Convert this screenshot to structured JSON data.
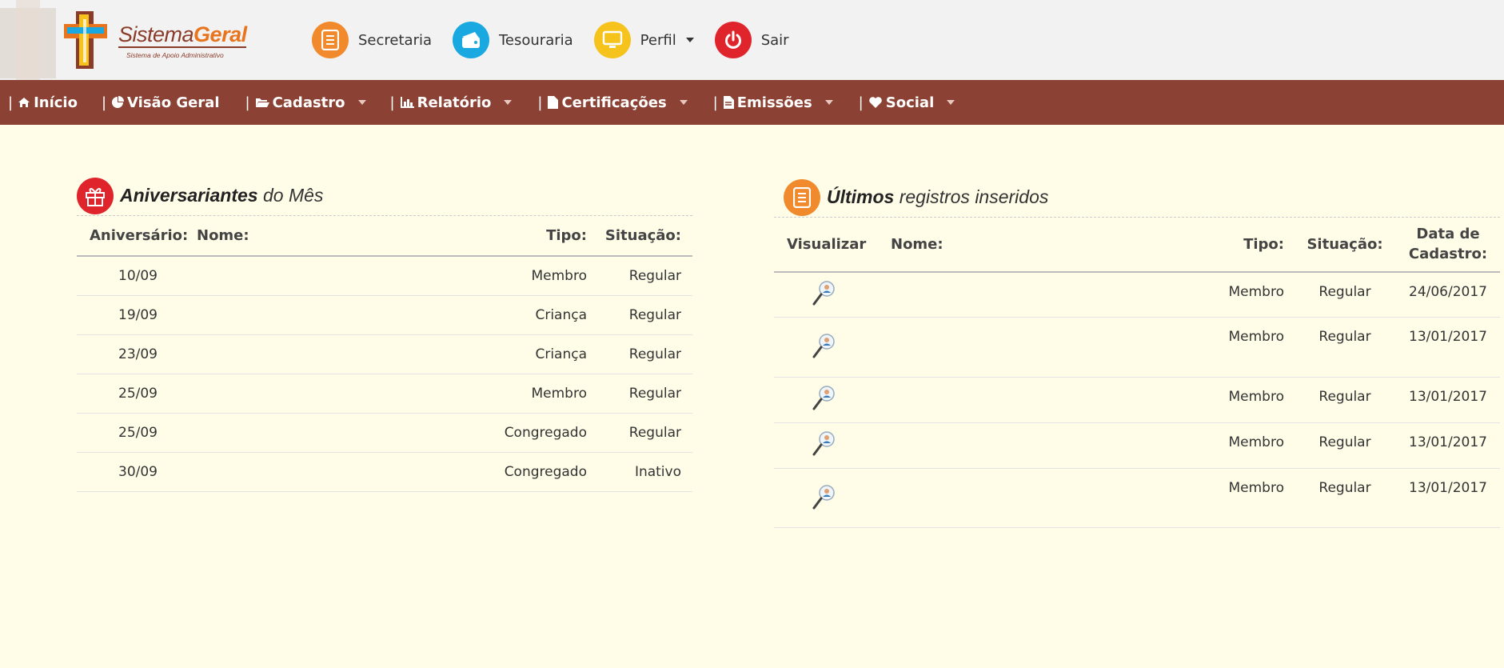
{
  "logo": {
    "brand_prefix": "Sistema",
    "brand_suffix": "Geral",
    "subtitle": "Sistema de Apoio Administrativo"
  },
  "topnav": [
    {
      "label": "Secretaria",
      "icon": "document-icon",
      "color": "#f08a2c"
    },
    {
      "label": "Tesouraria",
      "icon": "wallet-icon",
      "color": "#1aa8e0"
    },
    {
      "label": "Perfil",
      "icon": "monitor-icon",
      "color": "#f6c21c"
    },
    {
      "label": "Sair",
      "icon": "power-icon",
      "color": "#e0242c"
    }
  ],
  "menu": [
    {
      "label": "Início",
      "icon": "home-icon"
    },
    {
      "label": "Visão Geral",
      "icon": "pie-chart-icon"
    },
    {
      "label": "Cadastro",
      "icon": "folder-icon"
    },
    {
      "label": "Relatório",
      "icon": "bar-chart-icon"
    },
    {
      "label": "Certificações",
      "icon": "file-icon"
    },
    {
      "label": "Emissões",
      "icon": "file-text-icon"
    },
    {
      "label": "Social",
      "icon": "heart-icon"
    }
  ],
  "birthdays": {
    "title_bold": "Aniversariantes",
    "title_rest": "do Mês",
    "icon": "gift-icon",
    "headers": {
      "date": "Aniversário:",
      "name": "Nome:",
      "type": "Tipo:",
      "status": "Situação:"
    },
    "rows": [
      {
        "date": "10/09",
        "name": "",
        "type": "Membro",
        "status": "Regular"
      },
      {
        "date": "19/09",
        "name": "",
        "type": "Criança",
        "status": "Regular"
      },
      {
        "date": "23/09",
        "name": "",
        "type": "Criança",
        "status": "Regular"
      },
      {
        "date": "25/09",
        "name": "",
        "type": "Membro",
        "status": "Regular"
      },
      {
        "date": "25/09",
        "name": "",
        "type": "Congregado",
        "status": "Regular"
      },
      {
        "date": "30/09",
        "name": "",
        "type": "Congregado",
        "status": "Inativo"
      }
    ]
  },
  "recent": {
    "title_bold": "Últimos",
    "title_rest": "registros inseridos",
    "icon": "document-icon",
    "headers": {
      "view": "Visualizar",
      "name": "Nome:",
      "type": "Tipo:",
      "status": "Situação:",
      "date_line1": "Data de",
      "date_line2": "Cadastro:"
    },
    "rows": [
      {
        "name": "",
        "type": "Membro",
        "status": "Regular",
        "date": "24/06/2017"
      },
      {
        "name": "",
        "type": "Membro",
        "status": "Regular",
        "date": "13/01/2017"
      },
      {
        "name": "",
        "type": "Membro",
        "status": "Regular",
        "date": "13/01/2017"
      },
      {
        "name": "",
        "type": "Membro",
        "status": "Regular",
        "date": "13/01/2017"
      },
      {
        "name": "",
        "type": "Membro",
        "status": "Regular",
        "date": "13/01/2017"
      }
    ]
  }
}
